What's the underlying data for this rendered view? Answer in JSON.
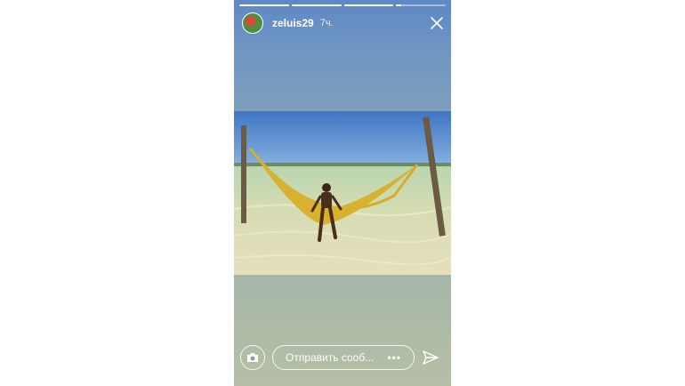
{
  "story": {
    "username": "zeluis29",
    "time_ago": "7ч.",
    "progress": [
      1.0,
      1.0,
      1.0,
      0.1
    ]
  },
  "footer": {
    "reply_placeholder": "Отправить сооб...",
    "more_label": "•••"
  },
  "icons": {
    "close": "close-icon",
    "camera": "camera-icon",
    "send": "send-icon"
  }
}
